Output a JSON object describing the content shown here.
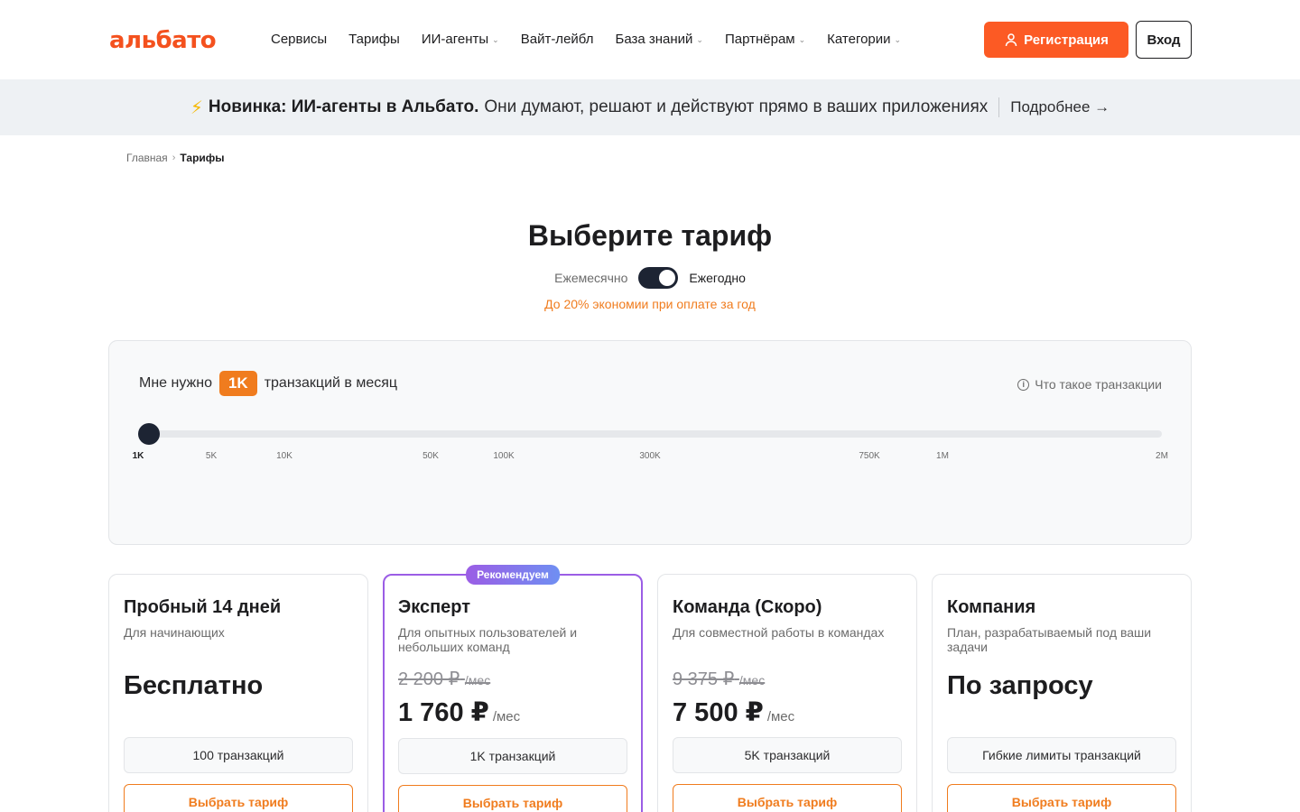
{
  "header": {
    "logo": "альбато",
    "nav": [
      {
        "label": "Сервисы",
        "dropdown": false
      },
      {
        "label": "Тарифы",
        "dropdown": false
      },
      {
        "label": "ИИ-агенты",
        "dropdown": true
      },
      {
        "label": "Вайт-лейбл",
        "dropdown": false
      },
      {
        "label": "База знаний",
        "dropdown": true
      },
      {
        "label": "Партнёрам",
        "dropdown": true
      },
      {
        "label": "Категории",
        "dropdown": true
      }
    ],
    "register_label": "Регистрация",
    "login_label": "Вход"
  },
  "banner": {
    "strong": "Новинка: ИИ-агенты в Альбато.",
    "text": "Они думают, решают и действуют прямо в ваших приложениях",
    "more": "Подробнее →"
  },
  "breadcrumb": {
    "home": "Главная",
    "current": "Тарифы"
  },
  "title": "Выберите тариф",
  "billing": {
    "monthly": "Ежемесячно",
    "yearly": "Ежегодно",
    "yearly_selected": true,
    "saving": "До 20% экономии при оплате за год"
  },
  "slider": {
    "prefix": "Мне нужно",
    "value": "1K",
    "suffix": "транзакций в месяц",
    "help": "Что такое транзакции",
    "ticks": [
      "1K",
      "5K",
      "10K",
      "50K",
      "100K",
      "300K",
      "750K",
      "1M",
      "2M"
    ],
    "selected_index": 0
  },
  "plans": [
    {
      "name": "Пробный 14 дней",
      "desc": "Для начинающих",
      "big": "Бесплатно",
      "limit": "100 транзакций",
      "cta": "Выбрать тариф"
    },
    {
      "badge": "Рекомендуем",
      "name": "Эксперт",
      "desc": "Для опытных пользователей и небольших команд",
      "old_price": "2 200 ₽",
      "old_unit": "/мес",
      "price": "1 760 ₽",
      "unit": "/мес",
      "limit": "1K транзакций",
      "cta": "Выбрать тариф"
    },
    {
      "name": "Команда (Скоро)",
      "desc": "Для совместной работы в командах",
      "old_price": "9 375 ₽",
      "old_unit": "/мес",
      "price": "7 500 ₽",
      "unit": "/мес",
      "limit": "5K транзакций",
      "cta": "Выбрать тариф"
    },
    {
      "name": "Компания",
      "desc": "План, разрабатываемый под ваши задачи",
      "big": "По запросу",
      "limit": "Гибкие лимиты транзакций",
      "cta": "Выбрать тариф"
    }
  ],
  "colors": {
    "brand": "#fc5a24",
    "accent": "#f07c1e",
    "featured_border": "#9b5de5",
    "dark": "#1d2433"
  }
}
